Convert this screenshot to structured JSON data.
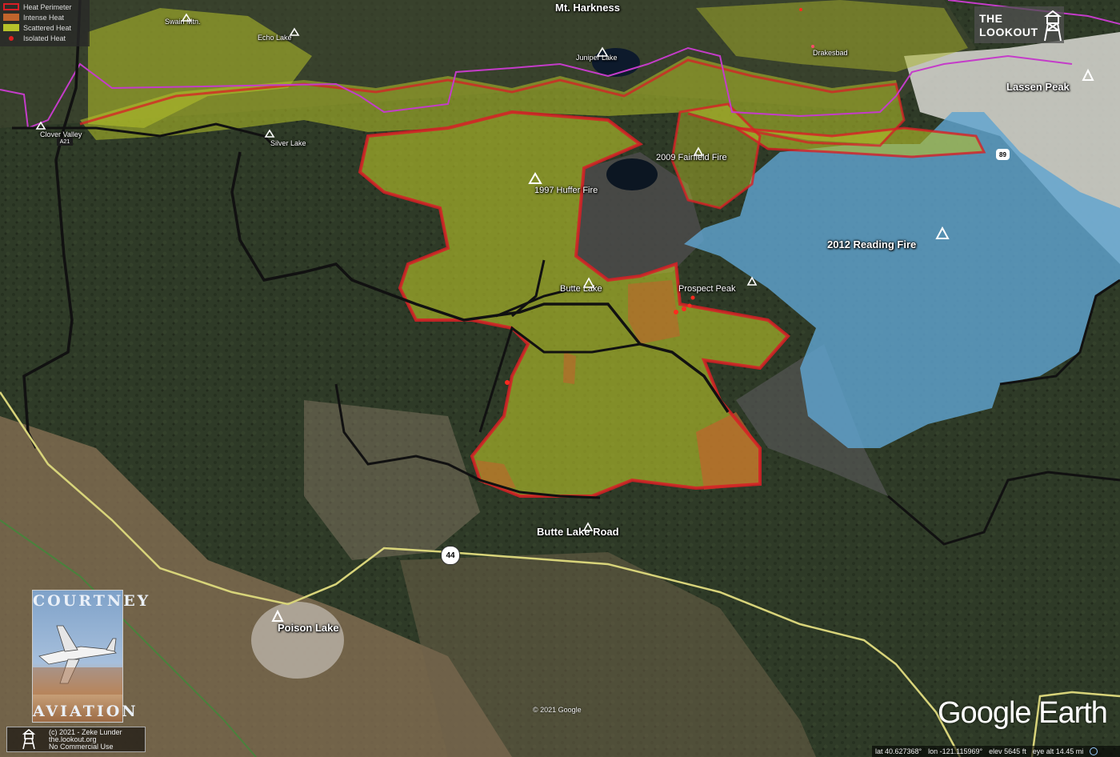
{
  "legend": {
    "items": [
      {
        "label": "Heat Perimeter",
        "color": "#d81f26",
        "style": "outline"
      },
      {
        "label": "Intense Heat",
        "color": "#c0642c",
        "style": "fill"
      },
      {
        "label": "Scattered Heat",
        "color": "#b7c22a",
        "style": "fill"
      },
      {
        "label": "Isolated Heat",
        "color": "#e0201f",
        "style": "dot"
      }
    ]
  },
  "brand": {
    "lookout_line1": "THE",
    "lookout_line2": "LOOKOUT",
    "courtney_top": "COURTNEY",
    "courtney_bottom": "AVIATION",
    "credit_line1": "(c) 2021 - Zeke Lunder",
    "credit_line2": "the.lookout.org",
    "credit_line3": "No Commercial Use",
    "ge_wordmark": "Google Earth",
    "copyright": "© 2021 Google"
  },
  "map_labels": {
    "mt_harkness": "Mt. Harkness",
    "swain_mtn": "Swain Mtn.",
    "echo_lake": "Echo Lake",
    "juniper_lake": "Juniper Lake",
    "drakesbad": "Drakesbad",
    "lassen_peak": "Lassen Peak",
    "clover_valley": "Clover Valley",
    "silver_lake": "Silver Lake",
    "huffer_fire": "1997 Huffer Fire",
    "fairfield_fire": "2009 Fairfield Fire",
    "reading_fire": "2012 Reading Fire",
    "butte_lake": "Butte Lake",
    "prospect_peak": "Prospect Peak",
    "butte_lake_road": "Butte Lake Road",
    "poison_lake": "Poison Lake"
  },
  "route_shields": {
    "hwy44": "44",
    "hwy89": "89",
    "a21": "A21"
  },
  "status": {
    "lat": "lat  40.627368°",
    "lon": "lon -121.115969°",
    "elev": "elev  5645 ft",
    "eye_alt": "eye alt  14.45 mi"
  },
  "colors": {
    "scattered_heat": "#b7c22a",
    "intense_heat": "#c0642c",
    "perimeter": "#d81f26",
    "old_fire_blue": "#5fa3d0",
    "park_boundary": "#c43cc9",
    "road": "#d8d47a"
  }
}
